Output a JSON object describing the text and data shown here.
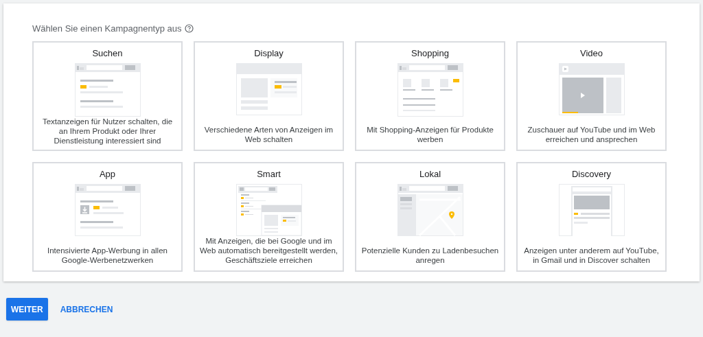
{
  "heading": "Wählen Sie einen Kampagnentyp aus",
  "campaign_types": [
    {
      "kind": "search",
      "title": "Suchen",
      "description": "Textanzeigen für Nutzer schalten, die an Ihrem Produkt oder Ihrer Dienstleistung interessiert sind"
    },
    {
      "kind": "display",
      "title": "Display",
      "description": "Verschiedene Arten von Anzeigen im Web schalten"
    },
    {
      "kind": "shopping",
      "title": "Shopping",
      "description": "Mit Shopping-Anzeigen für Produkte werben"
    },
    {
      "kind": "video",
      "title": "Video",
      "description": "Zuschauer auf YouTube und im Web erreichen und ansprechen"
    },
    {
      "kind": "app",
      "title": "App",
      "description": "Intensivierte App-Werbung in allen Google-Werbenetzwerken"
    },
    {
      "kind": "smart",
      "title": "Smart",
      "description": "Mit Anzeigen, die bei Google und im Web automatisch bereitgestellt werden, Geschäftsziele erreichen"
    },
    {
      "kind": "local",
      "title": "Lokal",
      "description": "Potenzielle Kunden zu Ladenbesuchen anregen"
    },
    {
      "kind": "discovery",
      "title": "Discovery",
      "description": "Anzeigen unter anderem auf YouTube, in Gmail und in Discover schalten"
    }
  ],
  "buttons": {
    "primary": "WEITER",
    "secondary": "ABBRECHEN"
  }
}
